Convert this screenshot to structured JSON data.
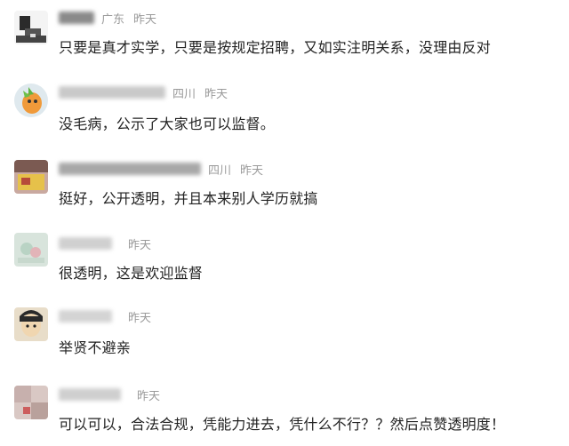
{
  "comments": [
    {
      "location": "广东",
      "time": "昨天",
      "text": "只要是真才实学，只要是按规定招聘，又如实注明关系，没理由反对"
    },
    {
      "location": "四川",
      "time": "昨天",
      "text": "没毛病，公示了大家也可以监督。"
    },
    {
      "location": "四川",
      "time": "昨天",
      "text": "挺好，公开透明，并且本来别人学历就搞"
    },
    {
      "location": "",
      "time": "昨天",
      "text": "很透明，这是欢迎监督"
    },
    {
      "location": "",
      "time": "昨天",
      "text": "举贤不避亲"
    },
    {
      "location": "",
      "time": "昨天",
      "text": "可以可以，合法合规，凭能力进去，凭什么不行？？然后点赞透明度！"
    }
  ]
}
